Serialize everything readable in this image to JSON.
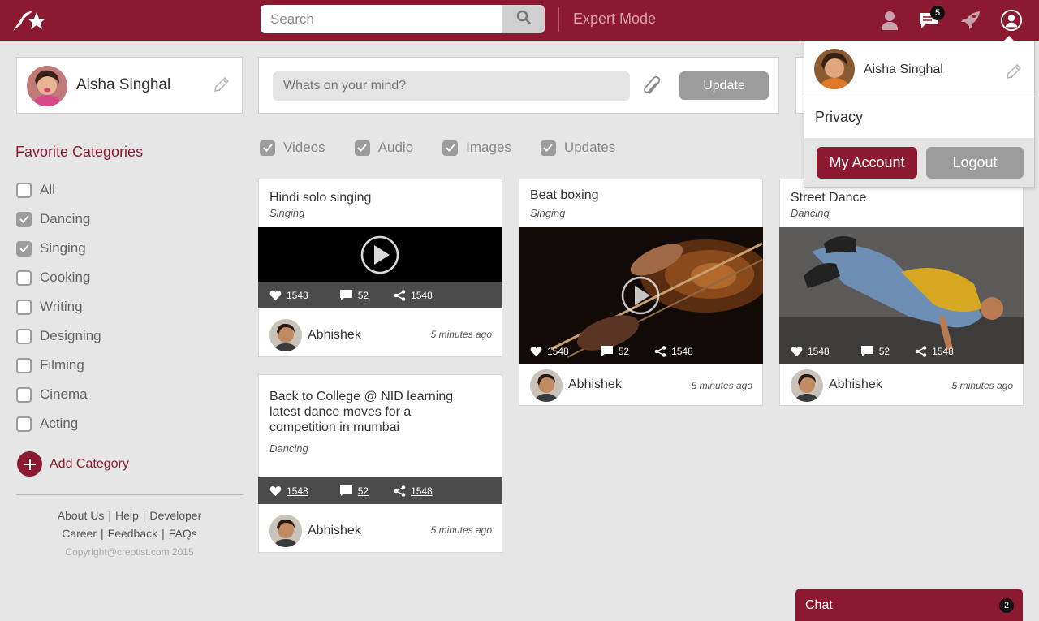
{
  "colors": {
    "brand": "#8b1a30",
    "background": "#e6e6e6",
    "checkbox": "#9c9c9c",
    "stats_bar": "#4b4b4b"
  },
  "header": {
    "search_placeholder": "Search",
    "expert_mode": "Expert Mode",
    "messages_badge": "5",
    "icons": [
      "logo-star-icon",
      "search-icon",
      "user-icon",
      "messages-icon",
      "rocket-icon",
      "account-circle-icon"
    ]
  },
  "profile": {
    "name": "Aisha Singhal"
  },
  "composer": {
    "placeholder": "Whats on your mind?",
    "update_label": "Update"
  },
  "sidebar": {
    "title": "Favorite Categories",
    "categories": [
      {
        "label": "All",
        "checked": false
      },
      {
        "label": "Dancing",
        "checked": true
      },
      {
        "label": "Singing",
        "checked": true
      },
      {
        "label": "Cooking",
        "checked": false
      },
      {
        "label": "Writing",
        "checked": false
      },
      {
        "label": "Designing",
        "checked": false
      },
      {
        "label": "Filming",
        "checked": false
      },
      {
        "label": "Cinema",
        "checked": false
      },
      {
        "label": "Acting",
        "checked": false
      }
    ],
    "add_category": "Add Category",
    "footer_links": [
      "About Us",
      "Help",
      "Developer",
      "Career",
      "Feedback",
      "FAQs"
    ],
    "separator": "|",
    "copyright": "Copyright@creotist.com 2015"
  },
  "filters": [
    {
      "label": "Videos",
      "checked": true
    },
    {
      "label": "Audio",
      "checked": true
    },
    {
      "label": "Images",
      "checked": true
    },
    {
      "label": "Updates",
      "checked": true
    }
  ],
  "posts": [
    {
      "title": "Hindi solo singing",
      "category": "Singing",
      "likes": "1548",
      "comments": "52",
      "shares": "1548",
      "author": "Abhishek",
      "time": "5 minutes ago"
    },
    {
      "title": "Beat boxing",
      "category": "Singing",
      "likes": "1548",
      "comments": "52",
      "shares": "1548",
      "author": "Abhishek",
      "time": "5 minutes ago"
    },
    {
      "title": "Street Dance",
      "category": "Dancing",
      "likes": "1548",
      "comments": "52",
      "shares": "1548",
      "author": "Abhishek",
      "time": "5 minutes ago"
    },
    {
      "title": "Back to College @ NID learning latest dance moves for a competition in mumbai",
      "category": "Dancing",
      "likes": "1548",
      "comments": "52",
      "shares": "1548",
      "author": "Abhishek",
      "time": "5 minutes ago"
    }
  ],
  "dropdown": {
    "name": "Aisha Singhal",
    "privacy": "Privacy",
    "my_account": "My Account",
    "logout": "Logout"
  },
  "chat": {
    "label": "Chat",
    "badge": "2"
  }
}
